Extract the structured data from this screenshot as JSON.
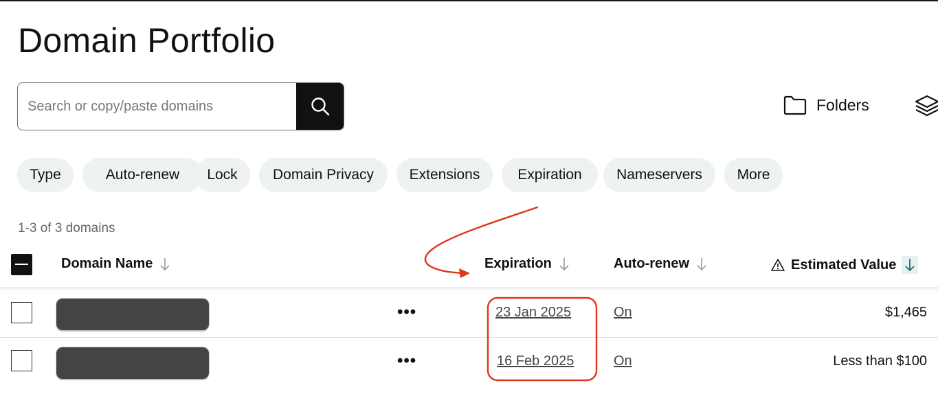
{
  "page": {
    "title": "Domain Portfolio"
  },
  "search": {
    "placeholder": "Search or copy/paste domains",
    "value": "",
    "button_icon": "search-icon"
  },
  "toolbar": {
    "folders_label": "Folders",
    "folders_icon": "folder-icon",
    "layers_icon": "layers-icon"
  },
  "filters": [
    "Type",
    "Auto-renew",
    "Lock",
    "Domain Privacy",
    "Extensions",
    "Expiration",
    "Nameservers",
    "More"
  ],
  "results": {
    "count_text": "1-3 of 3 domains"
  },
  "table": {
    "columns": {
      "domain": "Domain Name",
      "expiration": "Expiration",
      "auto_renew": "Auto-renew",
      "estimated_value": "Estimated Value"
    },
    "rows": [
      {
        "actions": "•••",
        "expiration": "23 Jan 2025",
        "auto_renew": "On",
        "estimated_value": "$1,465"
      },
      {
        "actions": "•••",
        "expiration": "16 Feb 2025",
        "auto_renew": "On",
        "estimated_value": "Less than $100"
      }
    ]
  },
  "colors": {
    "annotation": "#e0361c",
    "chip_bg": "#eef2f2",
    "sort_active": "#1f6f6f"
  }
}
